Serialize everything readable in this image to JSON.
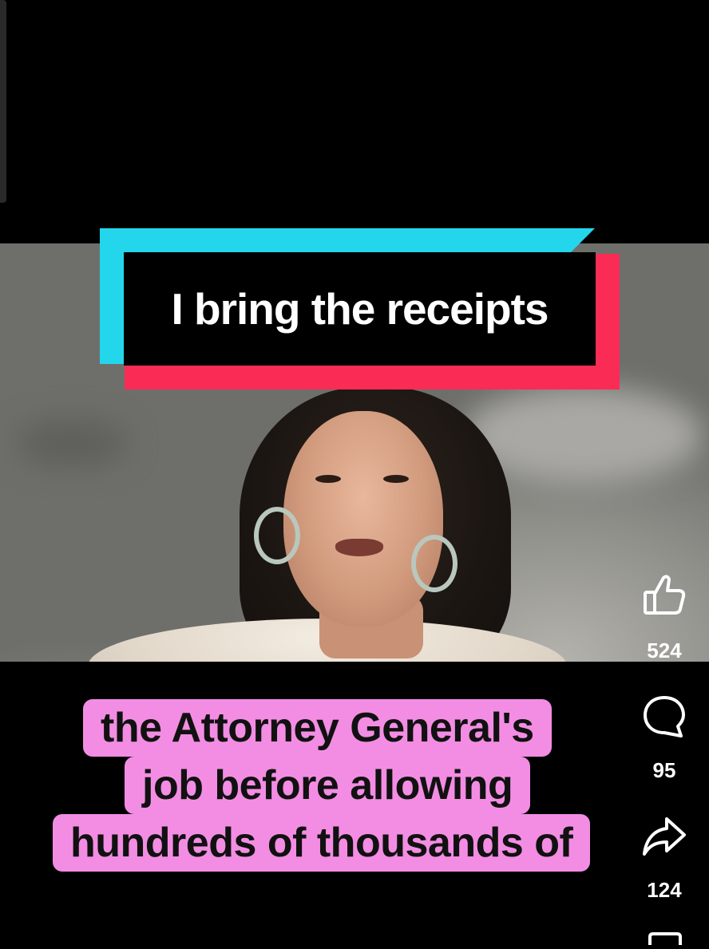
{
  "overlay": {
    "title": "I bring the receipts",
    "caption_lines": [
      "the Attorney General's",
      "job before allowing",
      "hundreds of thousands of"
    ]
  },
  "actions": {
    "like": {
      "icon": "thumbs-up-icon",
      "count": "524"
    },
    "comment": {
      "icon": "comment-bubble-icon",
      "count": "95"
    },
    "share": {
      "icon": "share-arrow-icon",
      "count": "124"
    }
  },
  "colors": {
    "banner_cyan": "#24d6ec",
    "banner_red": "#fa2c55",
    "caption_pink": "#f38de3"
  }
}
